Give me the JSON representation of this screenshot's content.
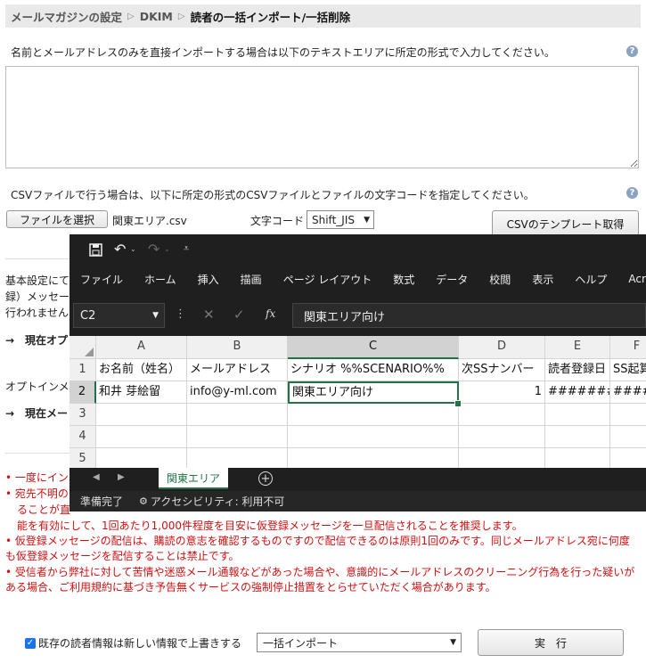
{
  "breadcrumb": [
    "メールマガジンの設定",
    "DKIM",
    "読者の一括インポート/一括削除"
  ],
  "direct_input": {
    "instruction": "名前とメールアドレスのみを直接インポートする場合は以下のテキストエリアに所定の形式で入力してください。",
    "value": ""
  },
  "csv": {
    "instruction": "CSVファイルで行う場合は、以下に所定の形式のCSVファイルとファイルの文字コードを指定してください。",
    "file_button": "ファイルを選択",
    "file_name": "関東エリア.csv",
    "encoding_label": "文字コード",
    "encoding_value": "Shift_JIS",
    "template_button": "CSVのテンプレート取得"
  },
  "partial_texts": {
    "t1": "基本設定にて",
    "t2": "録）メッセー",
    "t3": "行われません",
    "t4": "→　現在オプ",
    "t5": "オプトインメ",
    "t6": "→　現在メー"
  },
  "notes": [
    "一度にイン",
    "宛先不明の",
    "ることが直",
    "能を有効にして、1回あたり1,000件程度を目安に仮登録メッセージを一旦配信されることを推奨します。",
    "仮登録メッセージの配信は、購読の意志を確認するものですので配信できるのは原則1回のみです。同じメールアドレス宛に何度も仮登録メッセージを配信することは禁止です。",
    "受信者から弊社に対して苦情や迷惑メール通報などがあった場合や、意識的にメールアドレスのクリーニング行為を行った疑いがある場合、ご利用規約に基づき予告無くサービスの強制停止措置をとらせていただく場合があります。"
  ],
  "footer": {
    "overwrite_label": "既存の読者情報は新しい情報で上書きする",
    "overwrite_checked": true,
    "mode_value": "一括インポート",
    "execute_button": "実　行"
  },
  "excel": {
    "ribbon": [
      "ファイル",
      "ホーム",
      "挿入",
      "描画",
      "ページ レイアウト",
      "数式",
      "データ",
      "校閲",
      "表示",
      "ヘルプ",
      "Acrobat"
    ],
    "name_box": "C2",
    "fx_label": "fx",
    "formula": "関東エリア向け",
    "columns": [
      "A",
      "B",
      "C",
      "D",
      "E",
      "F"
    ],
    "rows": [
      "1",
      "2",
      "3",
      "4",
      "5"
    ],
    "cells": {
      "A1": "お名前（姓名）",
      "B1": "メールアドレス",
      "C1": "シナリオ %%SCENARIO%%",
      "D1": "次SSナンバー",
      "E1": "読者登録日",
      "F1": "SS起算",
      "A2": "和井 芽絵留",
      "B2": "info@y-ml.com",
      "C2": "関東エリア向け",
      "D2": "1",
      "E2": "#######",
      "F2": "####"
    },
    "sheet_tab": "関東エリア",
    "status_ready": "準備完了",
    "status_access": "アクセシビリティ: 利用不可",
    "accent": "#217346"
  }
}
